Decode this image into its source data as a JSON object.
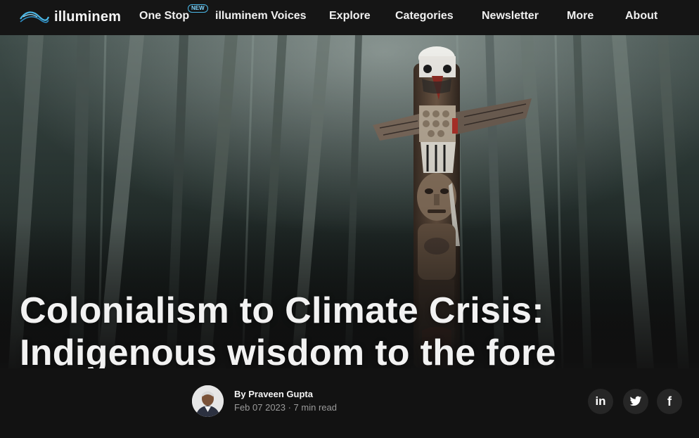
{
  "nav": {
    "logo_text": "illuminem",
    "items": [
      {
        "label": "One Stop",
        "badge": "NEW"
      },
      {
        "label": "illuminem Voices"
      },
      {
        "label": "Explore"
      },
      {
        "label": "Categories"
      },
      {
        "label": "Newsletter"
      },
      {
        "label": "More"
      },
      {
        "label": "About"
      }
    ]
  },
  "hero": {
    "title_line1": "Colonialism to Climate Crisis:",
    "title_line2": "Indigenous wisdom to the fore"
  },
  "article": {
    "byline": "By Praveen Gupta",
    "date_readtime": "Feb 07 2023 · 7 min read"
  },
  "share": [
    {
      "icon": "linkedin-icon",
      "glyph": "in"
    },
    {
      "icon": "twitter-icon"
    },
    {
      "icon": "facebook-icon",
      "glyph": "f"
    }
  ],
  "colors": {
    "nav_bg": "#151515",
    "accent": "#4bb8e8",
    "forest": "#2c3a37"
  }
}
